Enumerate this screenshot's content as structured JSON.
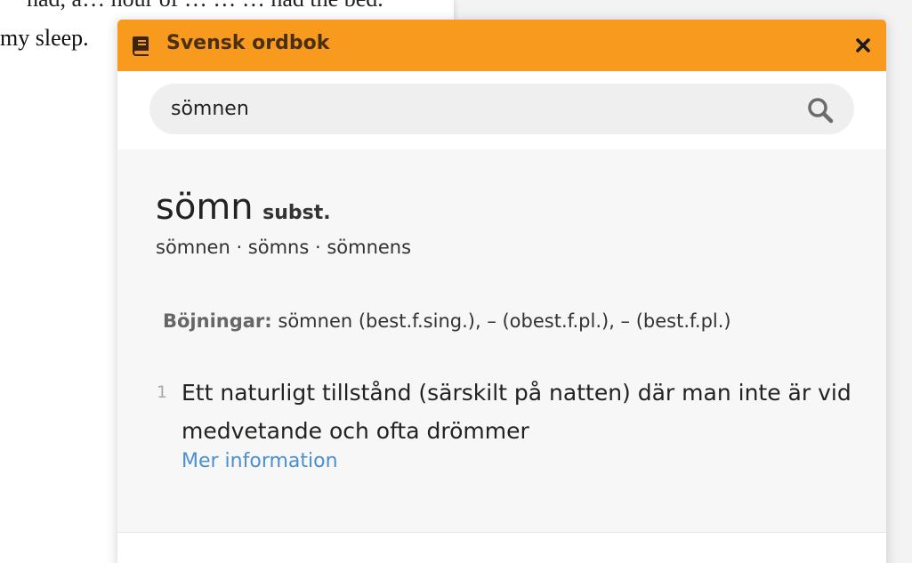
{
  "background_doc": {
    "line1": "had, a… hour of … … … had the bed.",
    "line2": "my sleep."
  },
  "popup": {
    "title": "Svensk ordbok",
    "header_color": "#f89a1e",
    "icons": {
      "title_icon": "book-icon",
      "close_icon": "close-icon",
      "search_icon": "search-icon"
    },
    "search": {
      "value": "sömnen",
      "placeholder": ""
    },
    "entry": {
      "headword": "sömn",
      "part_of_speech": "subst.",
      "forms": "sömnen · sömns · sömnens",
      "inflections_label": "Böjningar:",
      "inflections_text": "sömnen (best.f.sing.), – (obest.f.pl.), – (best.f.pl.)",
      "senses": [
        {
          "number": "1",
          "definition": "Ett naturligt tillstånd (särskilt på natten) där man inte är vid medvetande och ofta drömmer",
          "link_label": "Mer information",
          "link_color": "#4a90d0"
        }
      ]
    }
  }
}
